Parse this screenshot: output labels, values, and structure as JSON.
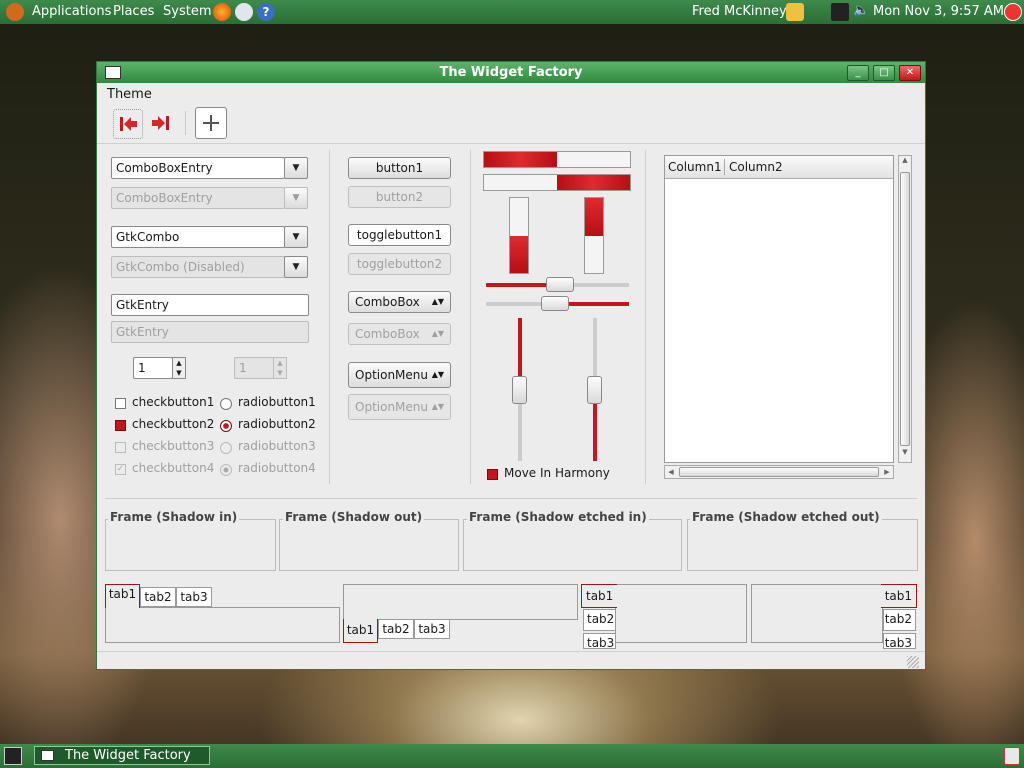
{
  "top_panel": {
    "applications": "Applications",
    "places": "Places",
    "system": "System",
    "user": "Fred McKinney",
    "clock": "Mon Nov  3,  9:57 AM"
  },
  "window": {
    "title": "The Widget Factory",
    "menu": [
      "Theme"
    ],
    "combos": {
      "entry": "ComboBoxEntry",
      "entry_disabled": "ComboBoxEntry",
      "gtkcombo": "GtkCombo",
      "gtkcombo_disabled": "GtkCombo (Disabled)",
      "gtkentry": "GtkEntry",
      "gtkentry_disabled": "GtkEntry",
      "spin": "1",
      "spin_disabled": "1"
    },
    "checks": [
      "checkbutton1",
      "checkbutton2",
      "checkbutton3",
      "checkbutton4"
    ],
    "radios": [
      "radiobutton1",
      "radiobutton2",
      "radiobutton3",
      "radiobutton4"
    ],
    "buttons": {
      "button1": "button1",
      "button2": "button2",
      "toggle1": "togglebutton1",
      "toggle2": "togglebutton2",
      "combobox": "ComboBox",
      "combobox_disabled": "ComboBox",
      "optionmenu": "OptionMenu",
      "optionmenu_disabled": "OptionMenu"
    },
    "progress": {
      "h1": 0.5,
      "h2": 0.5,
      "v1": 0.5,
      "v2": 0.5
    },
    "sliders": {
      "h1": 0.52,
      "h2": 0.48,
      "v1": 0.5,
      "v2": 0.5
    },
    "harmony_label": "Move In Harmony",
    "tree": {
      "columns": [
        "Column1",
        "Column2"
      ]
    },
    "frames": [
      "Frame (Shadow in)",
      "Frame (Shadow out)",
      "Frame (Shadow etched in)",
      "Frame (Shadow etched out)"
    ],
    "tabs": [
      "tab1",
      "tab2",
      "tab3"
    ]
  },
  "taskbar": {
    "item": "The Widget Factory"
  },
  "colors": {
    "accent": "#c4161c",
    "panel": "#2e7a3c"
  }
}
